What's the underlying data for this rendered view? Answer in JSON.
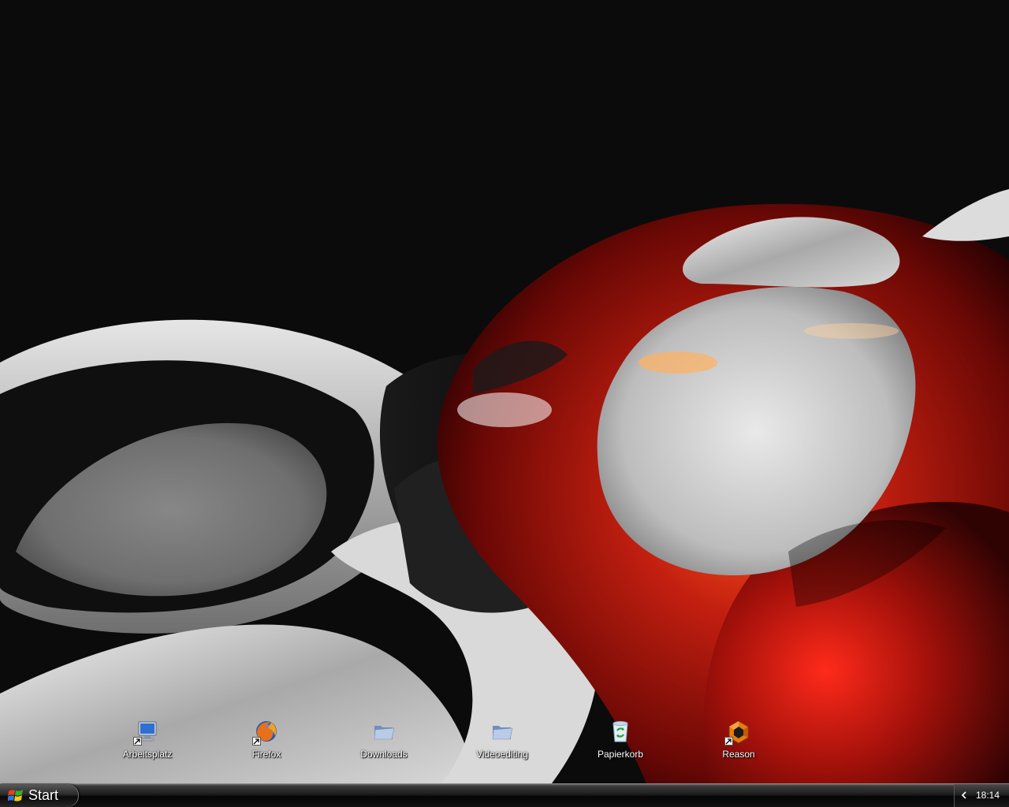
{
  "desktop": {
    "icons": [
      {
        "label": "Arbeitsplatz",
        "icon": "my-computer-icon",
        "shortcut": true
      },
      {
        "label": "Firefox",
        "icon": "firefox-icon",
        "shortcut": true
      },
      {
        "label": "Downloads",
        "icon": "folder-icon",
        "shortcut": false
      },
      {
        "label": "Videoediting",
        "icon": "folder-icon",
        "shortcut": false
      },
      {
        "label": "Papierkorb",
        "icon": "recycle-bin-icon",
        "shortcut": false
      },
      {
        "label": "Reason",
        "icon": "reason-icon",
        "shortcut": true
      }
    ]
  },
  "taskbar": {
    "start_label": "Start",
    "clock": "18:14",
    "tray_icon": "chevron-left-icon"
  },
  "colors": {
    "wallpaper_red": "#b01a10",
    "wallpaper_black": "#0b0b0b",
    "wallpaper_silver": "#cfcfcf"
  }
}
